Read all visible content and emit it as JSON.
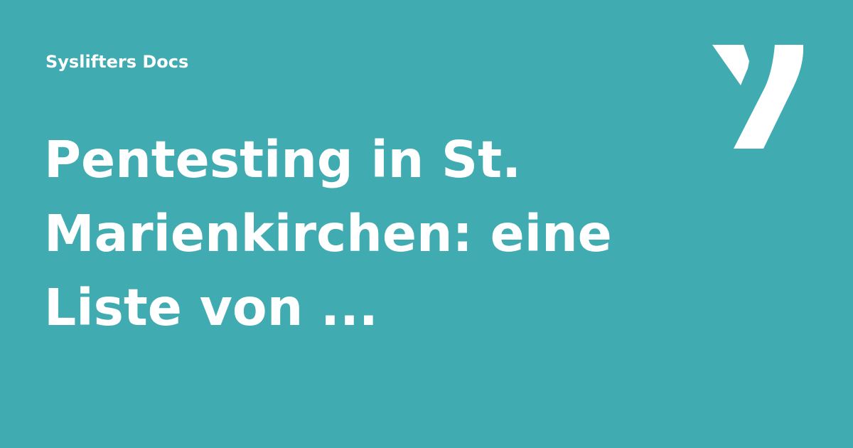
{
  "brand": {
    "site_name": "Syslifters Docs",
    "logo_icon": "syslifters-y-logo-icon",
    "background_color": "#40abb0",
    "text_color": "#ffffff"
  },
  "headline": {
    "line1": "Pentesting in St.",
    "line2": "Marienkirchen: eine",
    "line3": "Liste von ..."
  }
}
